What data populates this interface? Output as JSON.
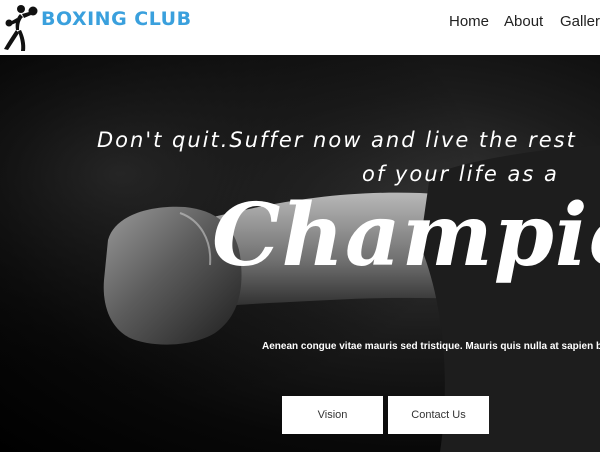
{
  "header": {
    "brand": "BOXING CLUB",
    "nav": [
      "Home",
      "About",
      "Gallery"
    ]
  },
  "hero": {
    "tagline_line1": "Don't quit.Suffer now and live the rest",
    "tagline_line2": "of your life as a",
    "headline": "Champion",
    "subtext": "Aenean congue vitae mauris sed tristique. Mauris quis nulla at sapien blandit.",
    "buttons": [
      "Vision",
      "Contact Us"
    ]
  },
  "colors": {
    "brand": "#3aa0dd",
    "hero_bg": "#000000",
    "button_bg": "#ffffff"
  },
  "icons": [
    "boxer-logo-icon"
  ]
}
